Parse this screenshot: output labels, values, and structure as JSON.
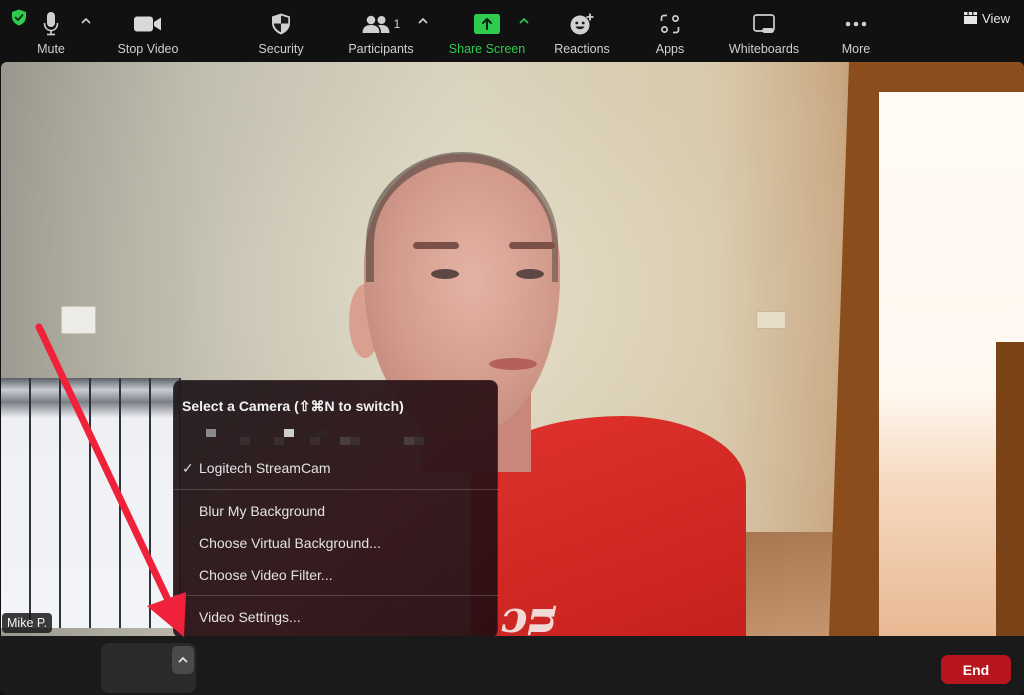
{
  "topbar": {
    "security_status": "encrypted",
    "view_label": "View"
  },
  "video": {
    "participant_name": "Mike P.",
    "shirt_text": "ɔᴝ"
  },
  "camera_menu": {
    "title": "Select a Camera (⇧⌘N to switch)",
    "hidden_camera_label": "[pixelated camera name]",
    "selected_camera": "Logitech StreamCam",
    "check_mark": "✓",
    "items": [
      {
        "label": "Blur My Background"
      },
      {
        "label": "Choose Virtual Background..."
      },
      {
        "label": "Choose Video Filter..."
      }
    ],
    "settings_label": "Video Settings..."
  },
  "toolbar": {
    "mute_label": "Mute",
    "stop_video_label": "Stop Video",
    "security_label": "Security",
    "participants_label": "Participants",
    "participants_count": "1",
    "share_screen_label": "Share Screen",
    "reactions_label": "Reactions",
    "apps_label": "Apps",
    "whiteboards_label": "Whiteboards",
    "more_label": "More",
    "end_label": "End",
    "caret": "^"
  },
  "colors": {
    "security_green": "#2fcb4e",
    "share_green": "#2fcb4e",
    "end_red": "#b8161e",
    "annotation_arrow": "#f0213a"
  }
}
